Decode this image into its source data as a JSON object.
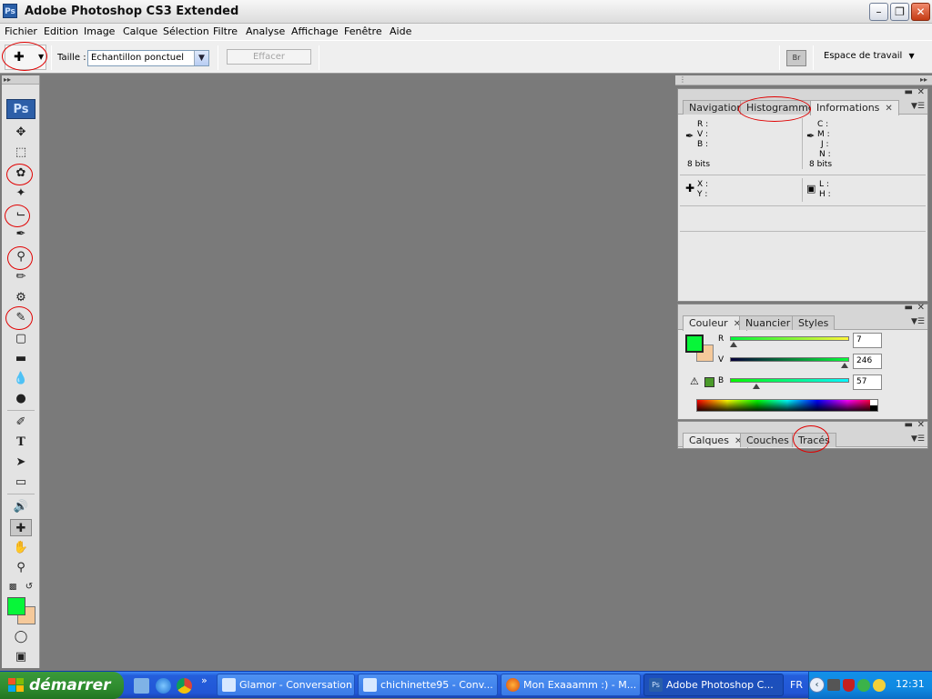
{
  "window": {
    "title": "Adobe Photoshop CS3 Extended",
    "app_icon": "Ps"
  },
  "menu": [
    "Fichier",
    "Edition",
    "Image",
    "Calque",
    "Sélection",
    "Filtre",
    "Analyse",
    "Affichage",
    "Fenêtre",
    "Aide"
  ],
  "options": {
    "size_label": "Taille :",
    "size_value": "Echantillon ponctuel",
    "clear_button": "Effacer",
    "workspace_label": "Espace de travail"
  },
  "toolbox": {
    "logo": "Ps"
  },
  "info_panel": {
    "tabs": [
      "Navigation",
      "Histogramme",
      "Informations"
    ],
    "rgb_labels": [
      "R :",
      "V :",
      "B :"
    ],
    "cmyk_labels": [
      "C :",
      "M :",
      "J :",
      "N :"
    ],
    "bits_left": "8 bits",
    "bits_right": "8 bits",
    "xy_labels": [
      "X :",
      "Y :"
    ],
    "lh_labels": [
      "L :",
      "H :"
    ]
  },
  "color_panel": {
    "tabs": [
      "Couleur",
      "Nuancier",
      "Styles"
    ],
    "channels": [
      {
        "label": "R",
        "value": "7"
      },
      {
        "label": "V",
        "value": "246"
      },
      {
        "label": "B",
        "value": "57"
      }
    ],
    "foreground_color": "#07f639",
    "background_color": "#f5c99a"
  },
  "layers_panel": {
    "tabs": [
      "Calques",
      "Couches",
      "Tracés"
    ]
  },
  "taskbar": {
    "start_label": "démarrer",
    "tasks": [
      "Glamor - Conversation",
      "chichinette95 - Conv...",
      "Mon Exaaamm :) - M...",
      "Adobe Photoshop C..."
    ],
    "language": "FR",
    "clock": "12:31"
  }
}
